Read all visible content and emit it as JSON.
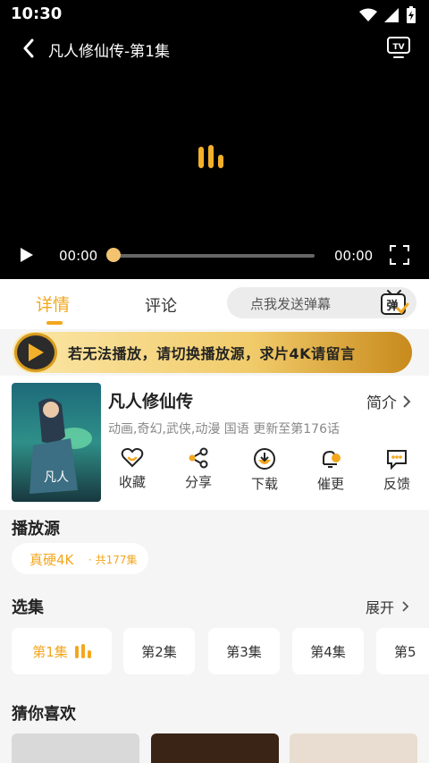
{
  "status": {
    "time": "10:30"
  },
  "header": {
    "title": "凡人修仙传-第1集"
  },
  "player": {
    "current_time": "00:00",
    "duration": "00:00",
    "progress": 0
  },
  "tabs": {
    "detail": "详情",
    "comment": "评论"
  },
  "danmu": {
    "placeholder": "点我发送弹幕",
    "icon_text": "弹"
  },
  "banner": {
    "text": "若无法播放，请切换播放源，求片4K请留言"
  },
  "show": {
    "name": "凡人修仙传",
    "intro_label": "简介",
    "meta": "动画,奇幻,武侠,动漫 国语 更新至第176话",
    "actions": [
      {
        "label": "收藏",
        "icon": "heart-icon"
      },
      {
        "label": "分享",
        "icon": "share-icon"
      },
      {
        "label": "下载",
        "icon": "download-icon"
      },
      {
        "label": "催更",
        "icon": "bell-icon"
      },
      {
        "label": "反馈",
        "icon": "feedback-icon"
      }
    ]
  },
  "source": {
    "title": "播放源",
    "name": "真硬4K",
    "count": "· 共177集"
  },
  "episodes": {
    "title": "选集",
    "expand_label": "展开",
    "items": [
      "第1集",
      "第2集",
      "第3集",
      "第4集",
      "第5"
    ]
  },
  "recommend": {
    "title": "猜你喜欢"
  },
  "colors": {
    "accent": "#f3a71e",
    "player_bg": "#000000"
  }
}
